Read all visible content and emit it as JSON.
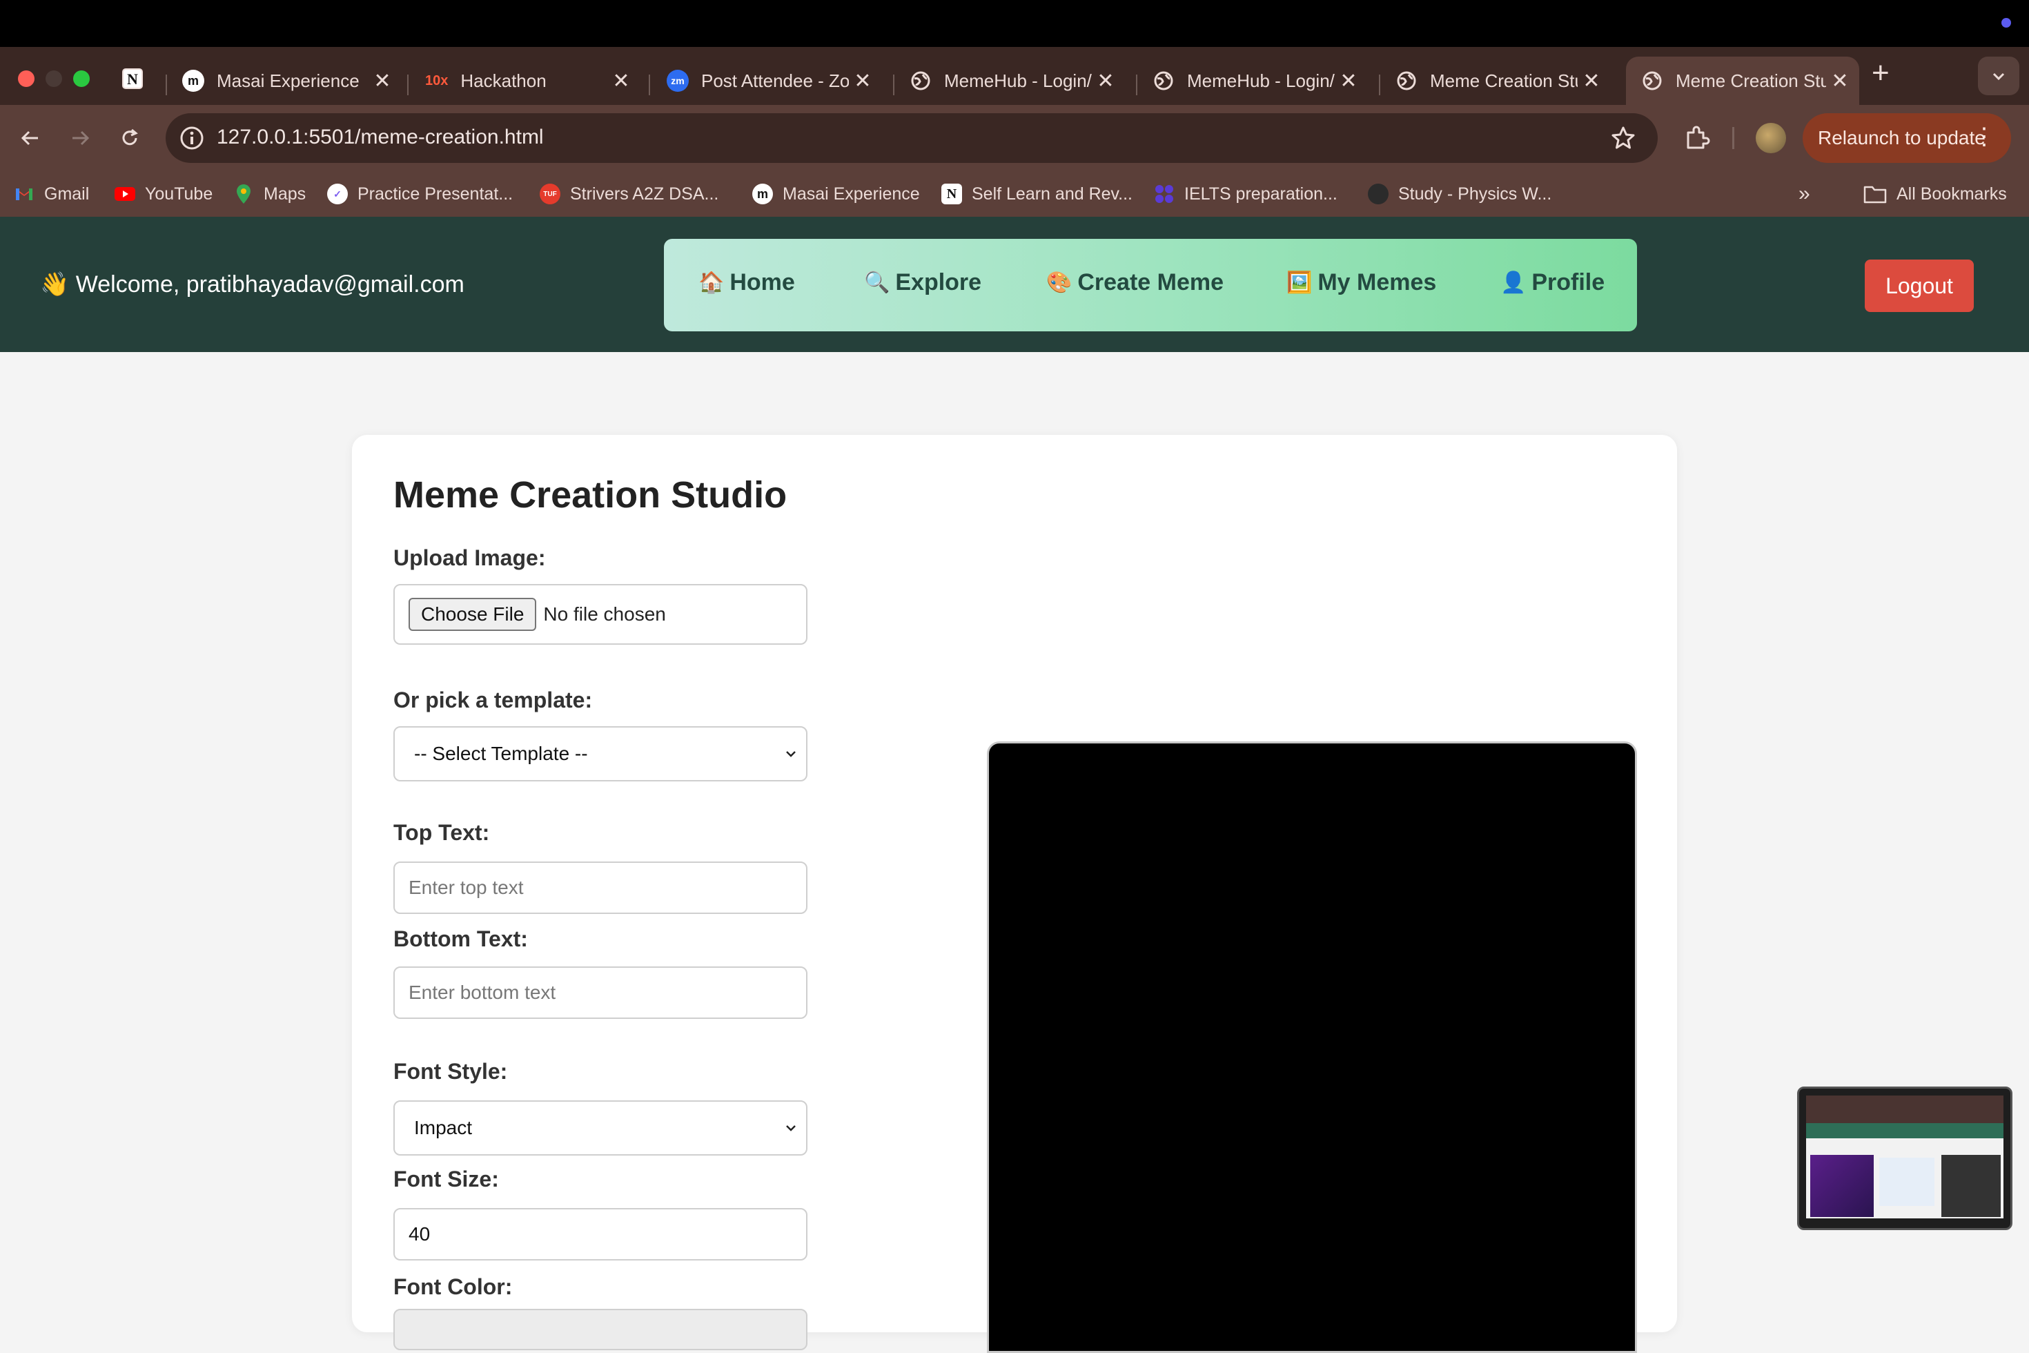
{
  "browser": {
    "tabs": [
      {
        "title": "Masai Experience",
        "favicon": "masai-icon"
      },
      {
        "title": "Hackathon",
        "favicon": "10x-icon"
      },
      {
        "title": "Post Attendee - Zoom",
        "favicon": "zoom-icon"
      },
      {
        "title": "MemeHub - Login/",
        "favicon": "globe-icon"
      },
      {
        "title": "MemeHub - Login/",
        "favicon": "globe-icon"
      },
      {
        "title": "Meme Creation Studio",
        "favicon": "globe-icon"
      },
      {
        "title": "Meme Creation Studio",
        "favicon": "globe-icon",
        "active": true
      }
    ],
    "url": "127.0.0.1:5501/meme-creation.html",
    "relaunch_label": "Relaunch to update",
    "bookmarks": [
      {
        "label": "Gmail",
        "icon": "gmail-icon"
      },
      {
        "label": "YouTube",
        "icon": "youtube-icon"
      },
      {
        "label": "Maps",
        "icon": "maps-icon"
      },
      {
        "label": "Practice Presentat...",
        "icon": "practice-icon"
      },
      {
        "label": "Strivers A2Z DSA...",
        "icon": "tuf-icon"
      },
      {
        "label": "Masai Experience",
        "icon": "masai-icon"
      },
      {
        "label": "Self Learn and Rev...",
        "icon": "notion-icon"
      },
      {
        "label": "IELTS preparation...",
        "icon": "ielts-icon"
      },
      {
        "label": "Study - Physics W...",
        "icon": "study-icon"
      }
    ],
    "all_bookmarks_label": "All Bookmarks"
  },
  "navbar": {
    "welcome_icon": "👋",
    "welcome_text": "Welcome, pratibhayadav@gmail.com",
    "menu": [
      {
        "icon": "🏠",
        "label": "Home"
      },
      {
        "icon": "🔍",
        "label": "Explore"
      },
      {
        "icon": "🎨",
        "label": "Create Meme"
      },
      {
        "icon": "🖼️",
        "label": "My Memes"
      },
      {
        "icon": "👤",
        "label": "Profile"
      }
    ],
    "logout_label": "Logout"
  },
  "studio": {
    "title": "Meme Creation Studio",
    "upload_label": "Upload Image:",
    "choose_file_label": "Choose File",
    "no_file_text": "No file chosen",
    "template_label": "Or pick a template:",
    "template_selected": "-- Select Template --",
    "top_text_label": "Top Text:",
    "top_text_placeholder": "Enter top text",
    "bottom_text_label": "Bottom Text:",
    "bottom_text_placeholder": "Enter bottom text",
    "font_style_label": "Font Style:",
    "font_style_selected": "Impact",
    "font_size_label": "Font Size:",
    "font_size_value": "40",
    "font_color_label": "Font Color:"
  },
  "colors": {
    "navbar_bg": "#25403a",
    "logout_bg": "#dc4b3e",
    "menu_text": "#234a40",
    "canvas_bg": "#000000"
  }
}
